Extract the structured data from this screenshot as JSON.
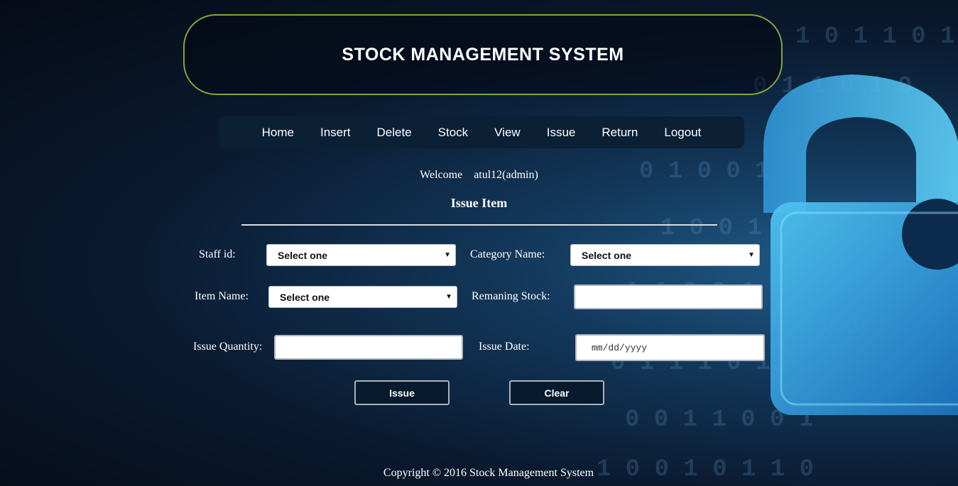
{
  "header": {
    "title": "STOCK MANAGEMENT SYSTEM"
  },
  "nav": {
    "items": [
      {
        "label": "Home"
      },
      {
        "label": "Insert"
      },
      {
        "label": "Delete"
      },
      {
        "label": "Stock"
      },
      {
        "label": "View"
      },
      {
        "label": "Issue"
      },
      {
        "label": "Return"
      },
      {
        "label": "Logout"
      }
    ]
  },
  "welcome": {
    "prefix": "Welcome",
    "user": "atul12(admin)"
  },
  "form": {
    "title": "Issue Item",
    "staff_id": {
      "label": "Staff id:",
      "value": "Select one"
    },
    "category": {
      "label": "Category Name:",
      "value": "Select one"
    },
    "item_name": {
      "label": "Item Name:",
      "value": "Select one"
    },
    "remaining_stock": {
      "label": "Remaning Stock:",
      "value": ""
    },
    "issue_quantity": {
      "label": "Issue Quantity:",
      "value": ""
    },
    "issue_date": {
      "label": "Issue Date:",
      "placeholder": "mm/dd/yyyy"
    },
    "issue_button": "Issue",
    "clear_button": "Clear"
  },
  "footer": {
    "copyright": "Copyright © 2016 Stock Management System"
  },
  "colors": {
    "header_border": "#7ea83a",
    "navbar_bg": "#0b1f35",
    "button_bg": "#071a2e",
    "lock_blue": "#2aa8e8"
  },
  "background": {
    "icon": "padlock-binary-icon"
  }
}
